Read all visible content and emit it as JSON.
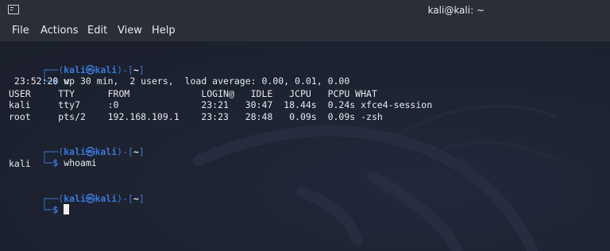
{
  "window": {
    "title": "kali@kali: ~"
  },
  "menu": {
    "items": [
      "File",
      "Actions",
      "Edit",
      "View",
      "Help"
    ]
  },
  "prompt": {
    "user": "kali",
    "host": "kali",
    "at_symbol": "㉿",
    "cwd": "~",
    "top_prefix": "┌──(",
    "mid": ")-[",
    "top_suffix": "]",
    "bottom": "└─",
    "dollar": "$"
  },
  "blocks": [
    {
      "command": "w",
      "output": [
        " 23:52:20 up 30 min,  2 users,  load average: 0.00, 0.01, 0.00",
        "USER     TTY      FROM             LOGIN@   IDLE   JCPU   PCPU WHAT",
        "kali     tty7     :0               23:21   30:47  18.44s  0.24s xfce4-session",
        "root     pts/2    192.168.109.1    23:23   28:48   0.09s  0.09s -zsh"
      ]
    },
    {
      "command": "whoami",
      "output": [
        "kali"
      ]
    },
    {
      "command": "",
      "output": []
    }
  ]
}
